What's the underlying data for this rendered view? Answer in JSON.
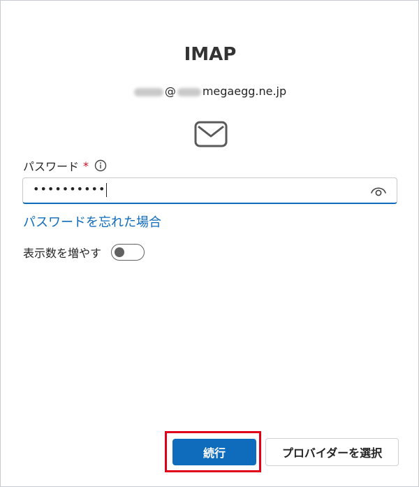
{
  "dialog": {
    "title": "IMAP",
    "email_at": "@",
    "email_domain": "megaegg.ne.jp"
  },
  "password": {
    "label": "パスワード",
    "required_mark": "*",
    "value": "••••••••••"
  },
  "links": {
    "forgot": "パスワードを忘れた場合"
  },
  "toggle": {
    "label": "表示数を増やす",
    "state": "off"
  },
  "buttons": {
    "continue": "続行",
    "select_provider": "プロバイダーを選択"
  },
  "colors": {
    "accent": "#0f6cbd",
    "highlight": "#e0001a",
    "required": "#c50f1f"
  }
}
